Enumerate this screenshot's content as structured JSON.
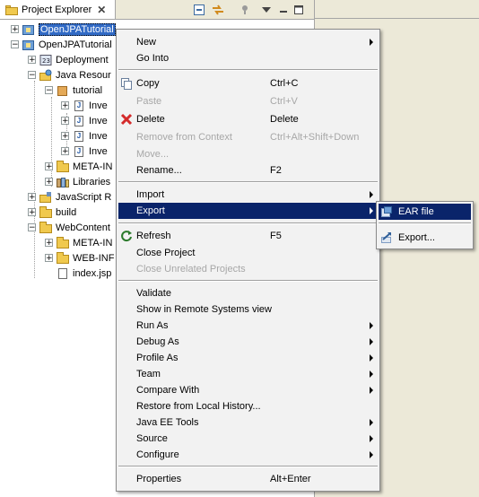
{
  "view": {
    "tab_title": "Project Explorer",
    "tab_close": "✕"
  },
  "tree": [
    {
      "label": "OpenJPATutorial",
      "expander": "+",
      "icon": "project-icon",
      "selected": true
    },
    {
      "label": "OpenJPATutorial",
      "expander": "−",
      "icon": "project-icon"
    },
    {
      "label": "Deployment",
      "expander": "+",
      "icon": "deployment-icon"
    },
    {
      "label": "Java Resour",
      "expander": "−",
      "icon": "java-resources-icon"
    },
    {
      "label": "tutorial",
      "expander": "−",
      "icon": "package-icon"
    },
    {
      "label": "Inve",
      "expander": "+",
      "icon": "java-file-icon"
    },
    {
      "label": "Inve",
      "expander": "+",
      "icon": "java-file-icon"
    },
    {
      "label": "Inve",
      "expander": "+",
      "icon": "java-file-icon"
    },
    {
      "label": "Inve",
      "expander": "+",
      "icon": "java-file-icon"
    },
    {
      "label": "META-IN",
      "expander": "+",
      "icon": "folder-icon"
    },
    {
      "label": "Libraries",
      "expander": "+",
      "icon": "libraries-icon"
    },
    {
      "label": "JavaScript R",
      "expander": "+",
      "icon": "javascript-icon"
    },
    {
      "label": "build",
      "expander": "+",
      "icon": "folder-icon"
    },
    {
      "label": "WebContent",
      "expander": "−",
      "icon": "folder-icon"
    },
    {
      "label": "META-IN",
      "expander": "+",
      "icon": "folder-icon"
    },
    {
      "label": "WEB-INF",
      "expander": "+",
      "icon": "folder-icon"
    },
    {
      "label": "index.jsp",
      "expander": "",
      "icon": "jsp-file-icon"
    }
  ],
  "menu": {
    "new": "New",
    "go_into": "Go Into",
    "copy": "Copy",
    "copy_acc": "Ctrl+C",
    "paste": "Paste",
    "paste_acc": "Ctrl+V",
    "delete": "Delete",
    "delete_acc": "Delete",
    "remove_ctx": "Remove from Context",
    "remove_ctx_acc": "Ctrl+Alt+Shift+Down",
    "move": "Move...",
    "rename": "Rename...",
    "rename_acc": "F2",
    "import": "Import",
    "export": "Export",
    "refresh": "Refresh",
    "refresh_acc": "F5",
    "close_project": "Close Project",
    "close_unrelated": "Close Unrelated Projects",
    "validate": "Validate",
    "show_remote": "Show in Remote Systems view",
    "run_as": "Run As",
    "debug_as": "Debug As",
    "profile_as": "Profile As",
    "team": "Team",
    "compare_with": "Compare With",
    "restore_history": "Restore from Local History...",
    "java_ee_tools": "Java EE Tools",
    "source": "Source",
    "configure": "Configure",
    "properties": "Properties",
    "properties_acc": "Alt+Enter"
  },
  "submenu": {
    "ear_file": "EAR file",
    "export": "Export..."
  },
  "colors": {
    "highlight": "#0a246a",
    "selection": "#316ac5",
    "menu_bg": "#f2f2f2",
    "chrome_bg": "#ece9d8"
  }
}
